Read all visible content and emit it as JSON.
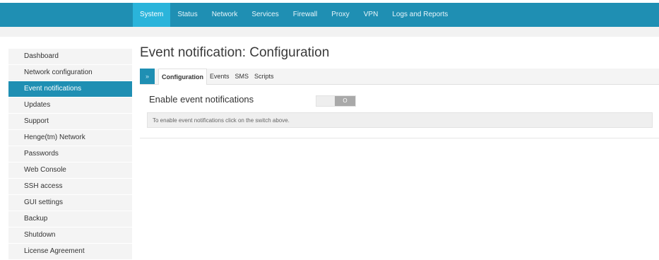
{
  "topnav": {
    "items": [
      {
        "label": "System",
        "active": true
      },
      {
        "label": "Status"
      },
      {
        "label": "Network"
      },
      {
        "label": "Services"
      },
      {
        "label": "Firewall"
      },
      {
        "label": "Proxy"
      },
      {
        "label": "VPN"
      },
      {
        "label": "Logs and Reports"
      }
    ]
  },
  "sidebar": {
    "items": [
      {
        "label": "Dashboard"
      },
      {
        "label": "Network configuration"
      },
      {
        "label": "Event notifications",
        "active": true
      },
      {
        "label": "Updates"
      },
      {
        "label": "Support"
      },
      {
        "label": "Henge(tm) Network"
      },
      {
        "label": "Passwords"
      },
      {
        "label": "Web Console"
      },
      {
        "label": "SSH access"
      },
      {
        "label": "GUI settings"
      },
      {
        "label": "Backup"
      },
      {
        "label": "Shutdown"
      },
      {
        "label": "License Agreement"
      }
    ]
  },
  "main": {
    "title": "Event notification: Configuration",
    "tab_toggle_icon": "»",
    "tabs": [
      {
        "label": "Configuration",
        "active": true
      },
      {
        "label": "Events"
      },
      {
        "label": "SMS"
      },
      {
        "label": "Scripts"
      }
    ],
    "setting_label": "Enable event notifications",
    "toggle_knob": "O",
    "notice": "To enable event notifications click on the switch above."
  },
  "colors": {
    "accent": "#1f8fb3",
    "accent_active": "#2ab4db"
  }
}
